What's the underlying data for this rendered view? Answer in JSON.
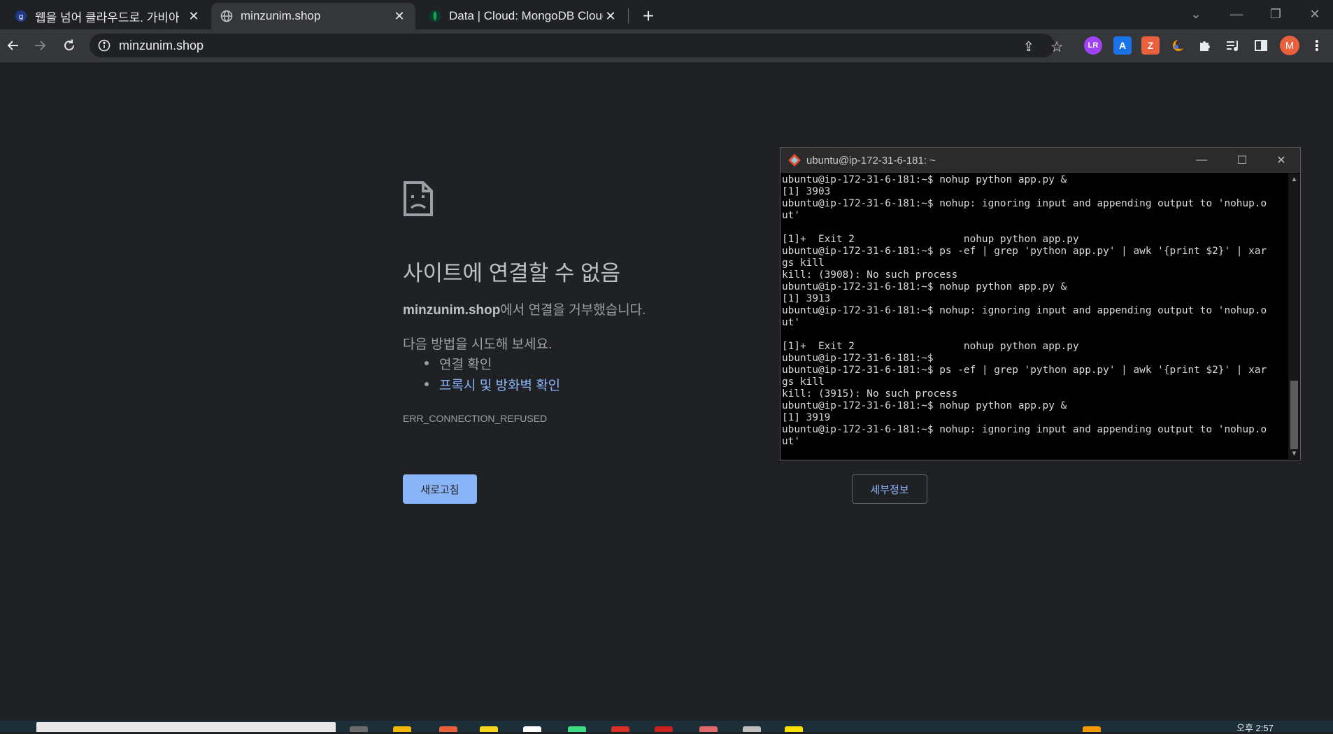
{
  "tabs": [
    {
      "title": "웹을 넘어 클라우드로. 가비아",
      "icon": "gabia-icon",
      "active": false
    },
    {
      "title": "minzunim.shop",
      "icon": "globe-icon",
      "active": true
    },
    {
      "title": "Data | Cloud: MongoDB Cloud",
      "icon": "mongodb-leaf-icon",
      "active": false
    }
  ],
  "toolbar": {
    "url": "minzunim.shop",
    "profile_initial": "M"
  },
  "extensions": [
    {
      "name": "lr-extension-icon",
      "label": "LR",
      "color": "#a142f4"
    },
    {
      "name": "translate-extension-icon",
      "label": "A",
      "color": "#1a73e8"
    },
    {
      "name": "zotero-extension-icon",
      "label": "Z",
      "color": "#e8603c"
    },
    {
      "name": "moon-extension-icon",
      "label": "",
      "color": "#f29900"
    }
  ],
  "error_page": {
    "title": "사이트에 연결할 수 없음",
    "domain": "minzunim.shop",
    "desc_suffix": "에서 연결을 거부했습니다.",
    "try_heading": "다음 방법을 시도해 보세요.",
    "suggestions": [
      "연결 확인",
      "프록시 및 방화벽 확인"
    ],
    "error_code": "ERR_CONNECTION_REFUSED",
    "reload_label": "새로고침",
    "details_label": "세부정보",
    "link_color": "#8ab4f8"
  },
  "terminal": {
    "title": "ubuntu@ip-172-31-6-181: ~",
    "lines": [
      "ubuntu@ip-172-31-6-181:~$ nohup python app.py &",
      "[1] 3903",
      "ubuntu@ip-172-31-6-181:~$ nohup: ignoring input and appending output to 'nohup.o",
      "ut'",
      "",
      "[1]+  Exit 2                  nohup python app.py",
      "ubuntu@ip-172-31-6-181:~$ ps -ef | grep 'python app.py' | awk '{print $2}' | xar",
      "gs kill",
      "kill: (3908): No such process",
      "ubuntu@ip-172-31-6-181:~$ nohup python app.py &",
      "[1] 3913",
      "ubuntu@ip-172-31-6-181:~$ nohup: ignoring input and appending output to 'nohup.o",
      "ut'",
      "",
      "[1]+  Exit 2                  nohup python app.py",
      "ubuntu@ip-172-31-6-181:~$",
      "ubuntu@ip-172-31-6-181:~$ ps -ef | grep 'python app.py' | awk '{print $2}' | xar",
      "gs kill",
      "kill: (3915): No such process",
      "ubuntu@ip-172-31-6-181:~$ nohup python app.py &",
      "[1] 3919",
      "ubuntu@ip-172-31-6-181:~$ nohup: ignoring input and appending output to 'nohup.o",
      "ut'",
      ""
    ]
  },
  "taskbar": {
    "clock": "오후 2:57"
  }
}
